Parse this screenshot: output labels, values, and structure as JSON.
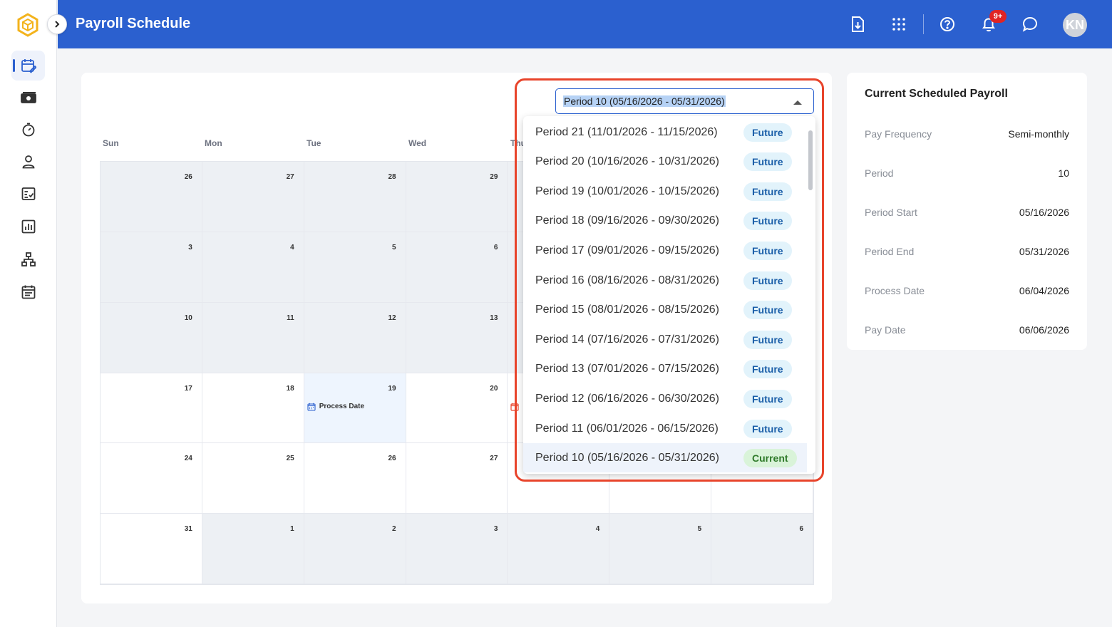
{
  "app": {
    "page_title": "Payroll Schedule",
    "user_initials": "KN",
    "notification_count": "9+",
    "colors": {
      "header": "#2b60cf",
      "accent": "#2b60cf",
      "highlight": "#e8442b",
      "logo": "#f3b31c"
    }
  },
  "sidebar": {
    "items": [
      {
        "icon": "calendar-edit-icon",
        "active": true
      },
      {
        "icon": "money-icon"
      },
      {
        "icon": "timer-icon"
      },
      {
        "icon": "person-icon"
      },
      {
        "icon": "checklist-icon"
      },
      {
        "icon": "bar-chart-icon"
      },
      {
        "icon": "org-chart-icon"
      },
      {
        "icon": "schedule-icon"
      }
    ]
  },
  "calendar": {
    "weekdays": [
      "Sun",
      "Mon",
      "Tue",
      "Wed",
      "Thu"
    ],
    "weeks": [
      [
        "26",
        "27",
        "28",
        "29",
        "",
        "",
        ""
      ],
      [
        "3",
        "4",
        "5",
        "6",
        "",
        "",
        ""
      ],
      [
        "10",
        "11",
        "12",
        "13",
        "",
        "",
        ""
      ],
      [
        "17",
        "18",
        "19",
        "20",
        "",
        "",
        ""
      ],
      [
        "24",
        "25",
        "26",
        "27",
        "",
        "",
        ""
      ],
      [
        "31",
        "1",
        "2",
        "3",
        "4",
        "5",
        "6"
      ]
    ],
    "events": {
      "process_date_label": "Process Date"
    }
  },
  "period_select": {
    "selected": "Period 10 (05/16/2026 - 05/31/2026)",
    "options": [
      {
        "label": "Period 21 (11/01/2026 - 11/15/2026)",
        "status": "Future"
      },
      {
        "label": "Period 20 (10/16/2026 - 10/31/2026)",
        "status": "Future"
      },
      {
        "label": "Period 19 (10/01/2026 - 10/15/2026)",
        "status": "Future"
      },
      {
        "label": "Period 18 (09/16/2026 - 09/30/2026)",
        "status": "Future"
      },
      {
        "label": "Period 17 (09/01/2026 - 09/15/2026)",
        "status": "Future"
      },
      {
        "label": "Period 16 (08/16/2026 - 08/31/2026)",
        "status": "Future"
      },
      {
        "label": "Period 15 (08/01/2026 - 08/15/2026)",
        "status": "Future"
      },
      {
        "label": "Period 14 (07/16/2026 - 07/31/2026)",
        "status": "Future"
      },
      {
        "label": "Period 13 (07/01/2026 - 07/15/2026)",
        "status": "Future"
      },
      {
        "label": "Period 12 (06/16/2026 - 06/30/2026)",
        "status": "Future"
      },
      {
        "label": "Period 11 (06/01/2026 - 06/15/2026)",
        "status": "Future"
      },
      {
        "label": "Period 10 (05/16/2026 - 05/31/2026)",
        "status": "Current"
      }
    ]
  },
  "summary": {
    "title": "Current Scheduled Payroll",
    "rows": [
      {
        "label": "Pay Frequency",
        "value": "Semi-monthly"
      },
      {
        "label": "Period",
        "value": "10"
      },
      {
        "label": "Period Start",
        "value": "05/16/2026"
      },
      {
        "label": "Period End",
        "value": "05/31/2026"
      },
      {
        "label": "Process Date",
        "value": "06/04/2026"
      },
      {
        "label": "Pay Date",
        "value": "06/06/2026"
      }
    ]
  }
}
